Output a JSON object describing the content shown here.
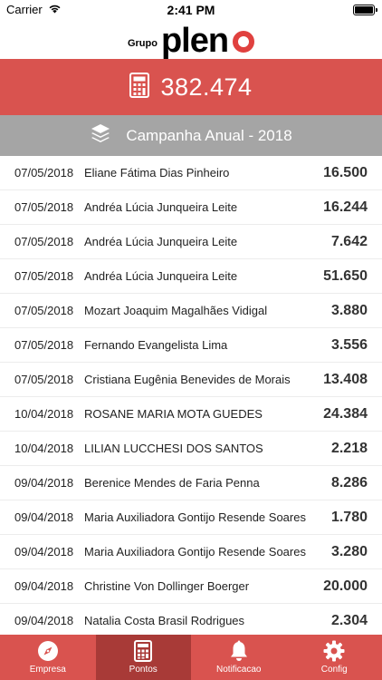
{
  "status_bar": {
    "carrier": "Carrier",
    "time": "2:41 PM"
  },
  "logo": {
    "small": "Grupo",
    "big": "plen"
  },
  "points": {
    "icon": "calculator-icon",
    "value": "382.474"
  },
  "campaign": {
    "icon": "layers-icon",
    "title": "Campanha Anual - 2018"
  },
  "entries": [
    {
      "date": "07/05/2018",
      "name": "Eliane Fátima Dias Pinheiro",
      "value": "16.500"
    },
    {
      "date": "07/05/2018",
      "name": "Andréa Lúcia Junqueira Leite",
      "value": "16.244"
    },
    {
      "date": "07/05/2018",
      "name": "Andréa Lúcia Junqueira Leite",
      "value": "7.642"
    },
    {
      "date": "07/05/2018",
      "name": "Andréa Lúcia Junqueira Leite",
      "value": "51.650"
    },
    {
      "date": "07/05/2018",
      "name": "Mozart Joaquim Magalhães Vidigal",
      "value": "3.880"
    },
    {
      "date": "07/05/2018",
      "name": "Fernando Evangelista Lima",
      "value": "3.556"
    },
    {
      "date": "07/05/2018",
      "name": "Cristiana Eugênia Benevides de Morais",
      "value": "13.408"
    },
    {
      "date": "10/04/2018",
      "name": "ROSANE MARIA MOTA GUEDES",
      "value": "24.384"
    },
    {
      "date": "10/04/2018",
      "name": "LILIAN LUCCHESI DOS SANTOS",
      "value": "2.218"
    },
    {
      "date": "09/04/2018",
      "name": "Berenice Mendes de Faria Penna",
      "value": "8.286"
    },
    {
      "date": "09/04/2018",
      "name": "Maria Auxiliadora Gontijo Resende Soares",
      "value": "1.780"
    },
    {
      "date": "09/04/2018",
      "name": "Maria Auxiliadora Gontijo Resende Soares",
      "value": "3.280"
    },
    {
      "date": "09/04/2018",
      "name": "Christine Von Dollinger Boerger",
      "value": "20.000"
    },
    {
      "date": "09/04/2018",
      "name": "Natalia Costa Brasil Rodrigues",
      "value": "2.304"
    }
  ],
  "tabs": [
    {
      "label": "Empresa",
      "icon": "compass-icon",
      "active": false
    },
    {
      "label": "Pontos",
      "icon": "calculator-icon",
      "active": true
    },
    {
      "label": "Notificacao",
      "icon": "bell-icon",
      "active": false
    },
    {
      "label": "Config",
      "icon": "gear-icon",
      "active": false
    }
  ],
  "colors": {
    "primary": "#d9534f",
    "tab_active": "#a83a37",
    "campaign_bg": "#a5a5a5",
    "logo_accent": "#e0413f"
  }
}
